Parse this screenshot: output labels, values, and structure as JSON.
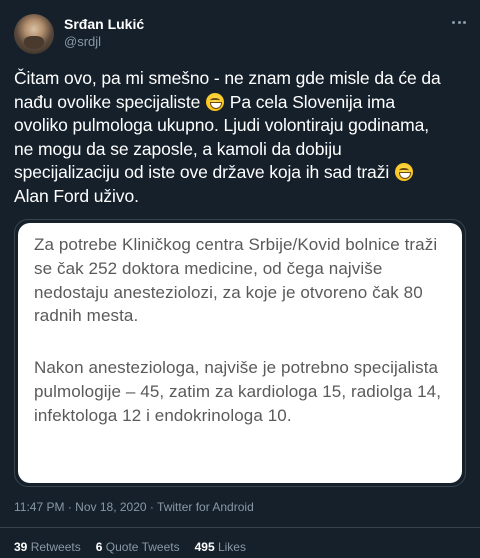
{
  "author": {
    "display_name": "Srđan Lukić",
    "handle": "@srdjl"
  },
  "tweet": {
    "line1": "Čitam ovo, pa mi smešno - ne znam gde misle da će da",
    "line2a": "nađu ovolike specijaliste",
    "line2b": "Pa cela Slovenija ima",
    "line3": "ovoliko pulmologa ukupno. Ljudi volontiraju godinama,",
    "line4": "ne mogu da se zaposle, a kamoli da dobiju",
    "line5": "specijalizaciju od iste ove države koja ih sad traži",
    "line6": "Alan Ford uživo.",
    "emoji": "grinning-face-with-smiling-eyes"
  },
  "media": {
    "paragraph1": "Za potrebe Kliničkog centra Srbije/Kovid bolnice traži se čak 252 doktora medicine, od čega najviše nedostaju anesteziolozi, za koje je otvoreno čak 80 radnih mesta.",
    "paragraph2": "Nakon anesteziologa, najviše je potrebno specijalista pulmologije – 45, zatim za kardiologa 15, radiolga 14,  infektologa 12 i endokrinologa 10."
  },
  "meta": {
    "time": "11:47 PM",
    "date": "Nov 18, 2020",
    "source": "Twitter for Android"
  },
  "stats": {
    "retweets_count": "39",
    "retweets_label": "Retweets",
    "quotes_count": "6",
    "quotes_label": "Quote Tweets",
    "likes_count": "495",
    "likes_label": "Likes"
  },
  "colors": {
    "background": "#15202b",
    "text": "#ffffff",
    "muted": "#8899a6",
    "border": "#38444d"
  }
}
